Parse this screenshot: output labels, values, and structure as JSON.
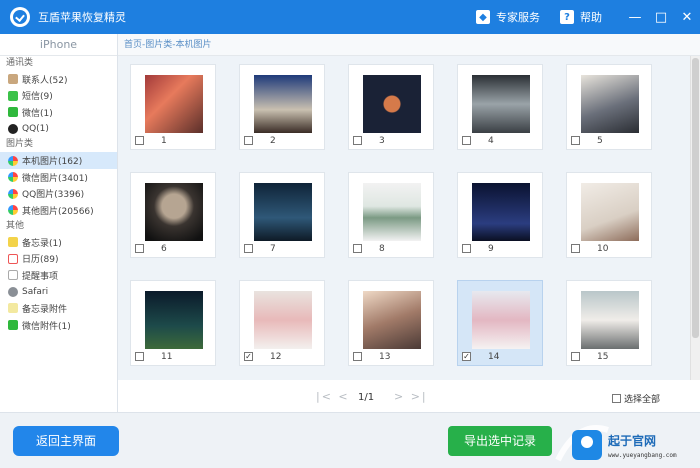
{
  "app": {
    "title": "互盾苹果恢复精灵"
  },
  "titlebar": {
    "expert_label": "专家服务",
    "help_label": "帮助",
    "minimize": "—",
    "maximize": "□",
    "close": "✕"
  },
  "sidebar": {
    "device": "iPhone",
    "groups": [
      {
        "label": "通讯类",
        "items": [
          "联系人(52)",
          "短信(9)",
          "微信(1)",
          "QQ(1)"
        ]
      },
      {
        "label": "图片类",
        "items": [
          "本机图片(162)",
          "微信图片(3401)",
          "QQ图片(3396)",
          "其他图片(20566)"
        ]
      },
      {
        "label": "其他",
        "items": [
          "备忘录(1)",
          "日历(89)",
          "提醒事项",
          "Safari",
          "备忘录附件",
          "微信附件(1)"
        ]
      }
    ]
  },
  "breadcrumb": "首页-图片类-本机图片",
  "photos": [
    {
      "n": "1",
      "checked": false,
      "selected": false
    },
    {
      "n": "2",
      "checked": false,
      "selected": false
    },
    {
      "n": "3",
      "checked": false,
      "selected": false
    },
    {
      "n": "4",
      "checked": false,
      "selected": false
    },
    {
      "n": "5",
      "checked": false,
      "selected": false
    },
    {
      "n": "6",
      "checked": false,
      "selected": false
    },
    {
      "n": "7",
      "checked": false,
      "selected": false
    },
    {
      "n": "8",
      "checked": false,
      "selected": false
    },
    {
      "n": "9",
      "checked": false,
      "selected": false
    },
    {
      "n": "10",
      "checked": false,
      "selected": false
    },
    {
      "n": "11",
      "checked": false,
      "selected": false
    },
    {
      "n": "12",
      "checked": true,
      "selected": false
    },
    {
      "n": "13",
      "checked": false,
      "selected": false
    },
    {
      "n": "14",
      "checked": true,
      "selected": true
    },
    {
      "n": "15",
      "checked": false,
      "selected": false
    }
  ],
  "pager": {
    "first_prev": "|< <",
    "page": "1/1",
    "next_last": "> >|",
    "select_all": "选择全部"
  },
  "footer": {
    "back_label": "返回主界面",
    "export_label": "导出选中记录"
  },
  "watermark": {
    "text": "起于官网",
    "url": "www.yueyangbang.com"
  },
  "colors": {
    "accent": "#1e7fe0",
    "export": "#27b04a",
    "selected_row": "#d7e9fb"
  }
}
